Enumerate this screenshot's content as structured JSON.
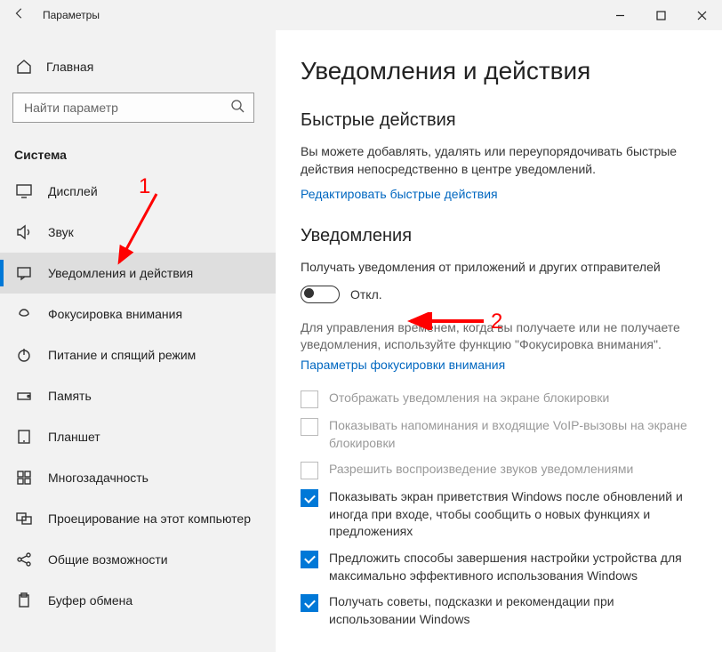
{
  "window": {
    "title": "Параметры"
  },
  "sidebar": {
    "home": "Главная",
    "search_placeholder": "Найти параметр",
    "section": "Система",
    "items": [
      {
        "label": "Дисплей"
      },
      {
        "label": "Звук"
      },
      {
        "label": "Уведомления и действия"
      },
      {
        "label": "Фокусировка внимания"
      },
      {
        "label": "Питание и спящий режим"
      },
      {
        "label": "Память"
      },
      {
        "label": "Планшет"
      },
      {
        "label": "Многозадачность"
      },
      {
        "label": "Проецирование на этот компьютер"
      },
      {
        "label": "Общие возможности"
      },
      {
        "label": "Буфер обмена"
      }
    ]
  },
  "content": {
    "title": "Уведомления и действия",
    "quick_hdr": "Быстрые действия",
    "quick_txt": "Вы можете добавлять, удалять или переупорядочивать быстрые действия непосредственно в центре уведомлений.",
    "quick_link": "Редактировать быстрые действия",
    "notif_hdr": "Уведомления",
    "toggle_title": "Получать уведомления от приложений и других отправителей",
    "toggle_state": "Откл.",
    "focus_help": "Для управления временем, когда вы получаете или не получаете уведомления, используйте функцию \"Фокусировка внимания\".",
    "focus_link": "Параметры фокусировки внимания",
    "checks": [
      {
        "label": "Отображать уведомления на экране блокировки",
        "disabled": true,
        "checked": false
      },
      {
        "label": "Показывать напоминания и входящие VoIP-вызовы на экране блокировки",
        "disabled": true,
        "checked": false
      },
      {
        "label": "Разрешить  воспроизведение звуков уведомлениями",
        "disabled": true,
        "checked": false
      },
      {
        "label": "Показывать экран приветствия Windows после обновлений и иногда при входе, чтобы сообщить о новых функциях и предложениях",
        "disabled": false,
        "checked": true
      },
      {
        "label": "Предложить способы завершения настройки устройства для максимально эффективного использования Windows",
        "disabled": false,
        "checked": true
      },
      {
        "label": "Получать советы, подсказки и рекомендации при использовании Windows",
        "disabled": false,
        "checked": true
      }
    ]
  },
  "annotations": {
    "n1": "1",
    "n2": "2"
  }
}
